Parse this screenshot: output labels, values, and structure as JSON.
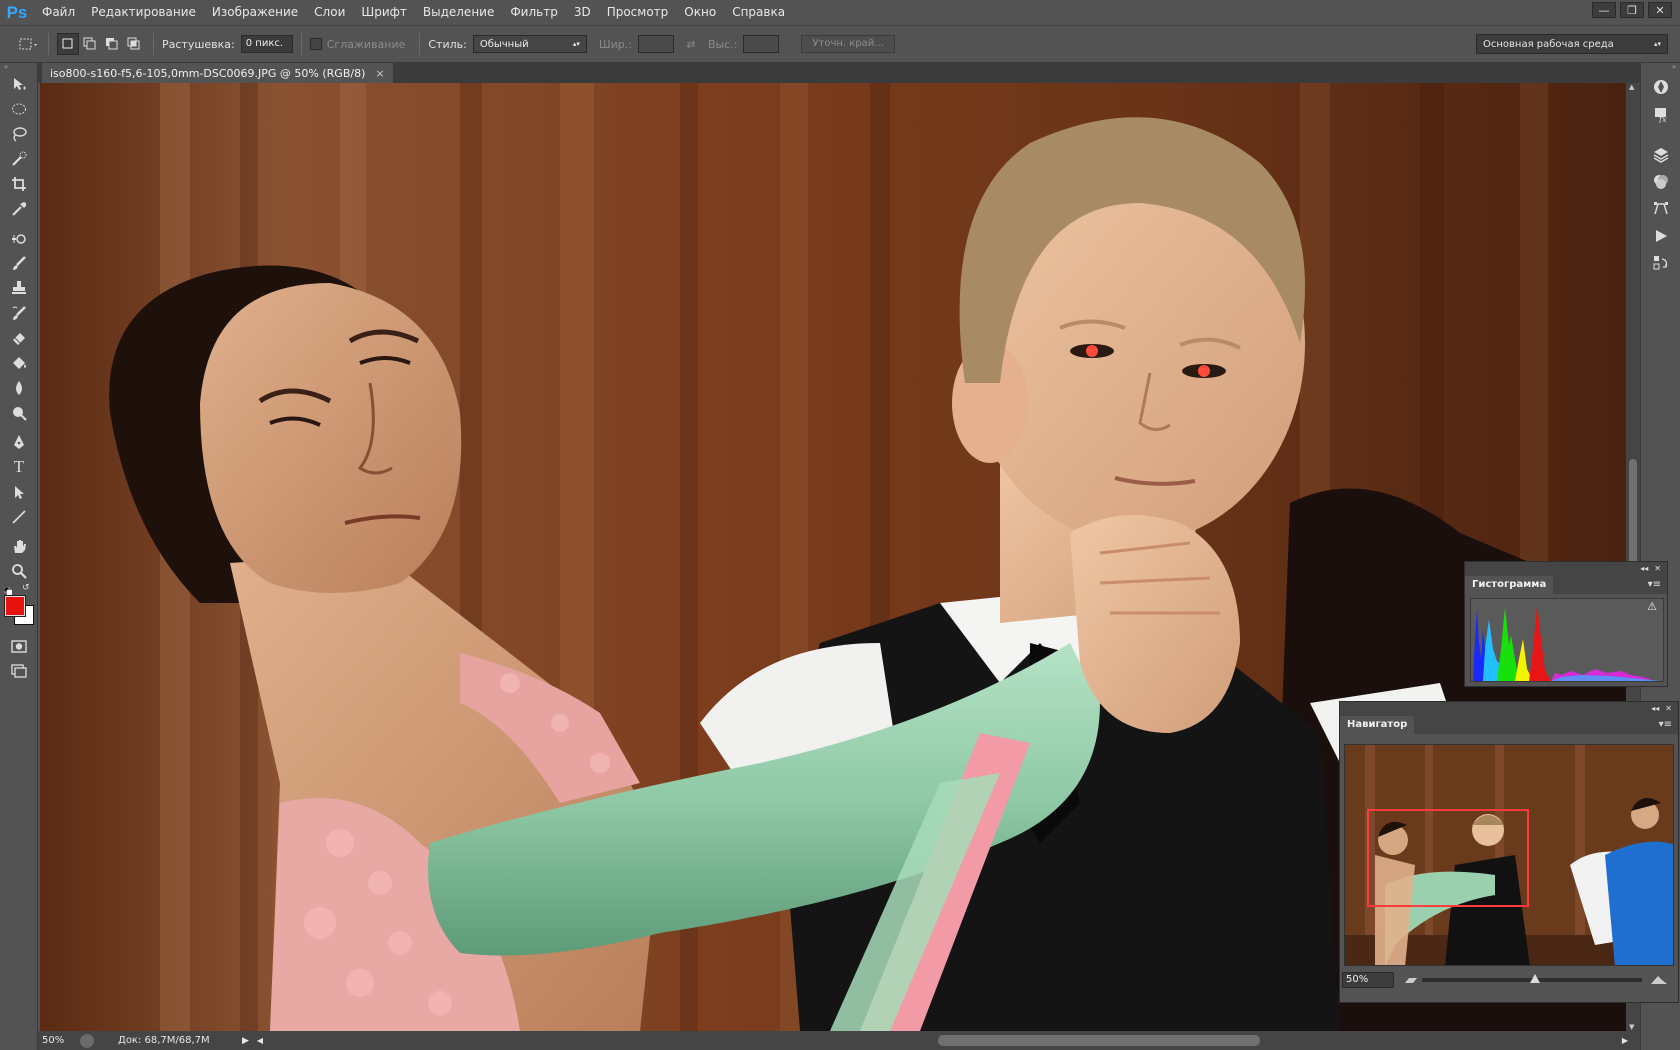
{
  "app": {
    "logo": "Ps"
  },
  "menu": [
    "Файл",
    "Редактирование",
    "Изображение",
    "Слои",
    "Шрифт",
    "Выделение",
    "Фильтр",
    "3D",
    "Просмотр",
    "Окно",
    "Справка"
  ],
  "window_controls": {
    "minimize": "—",
    "restore": "❐",
    "close": "✕"
  },
  "options": {
    "feather_label": "Растушевка:",
    "feather_value": "0 пикс.",
    "antialias_label": "Сглаживание",
    "style_label": "Стиль:",
    "style_value": "Обычный",
    "width_label": "Шир.:",
    "height_label": "Выс.:",
    "refine_button": "Уточн. край...",
    "workspace": "Основная рабочая среда"
  },
  "document": {
    "tab_title": "iso800-s160-f5,6-105,0mm-DSC0069.JPG @ 50% (RGB/8)",
    "tab_close": "×"
  },
  "status": {
    "zoom": "50%",
    "doc_info": "Док: 68,7M/68,7M"
  },
  "panels": {
    "histogram": {
      "title": "Гистограмма",
      "warning": "⚠"
    },
    "navigator": {
      "title": "Навигатор",
      "zoom": "50%"
    }
  },
  "colors": {
    "foreground": "#e8120e",
    "background": "#ffffff",
    "nav_view_box": "#ff3b3b"
  },
  "tools": [
    "move-icon",
    "marquee-ellipse-icon",
    "lasso-icon",
    "quick-selection-icon",
    "crop-icon",
    "eyedropper-icon",
    "healing-icon",
    "brush-icon",
    "stamp-icon",
    "history-brush-icon",
    "eraser-icon",
    "paint-bucket-icon",
    "blur-icon",
    "dodge-icon",
    "pen-icon",
    "type-icon",
    "path-select-icon",
    "line-icon",
    "hand-icon",
    "zoom-icon"
  ]
}
